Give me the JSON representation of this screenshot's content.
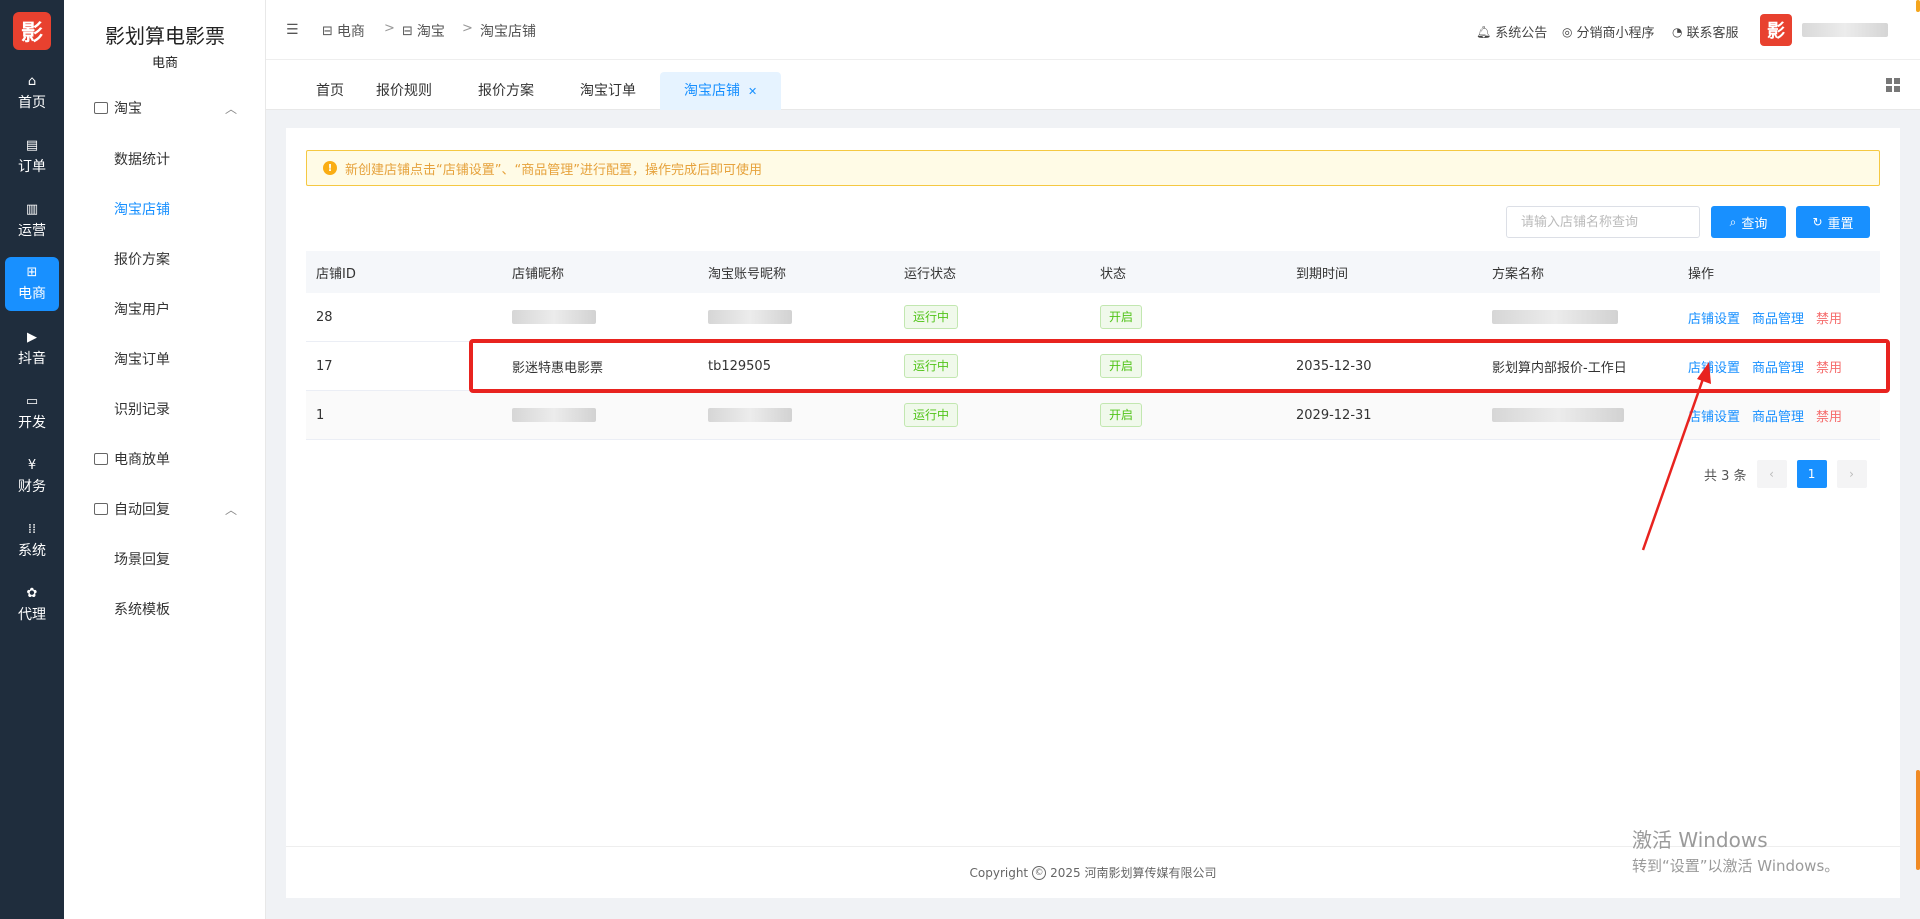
{
  "rail": {
    "logo": "影",
    "items": [
      {
        "label": "首页",
        "icon": "home-icon",
        "glyph": "⌂"
      },
      {
        "label": "订单",
        "icon": "order-icon",
        "glyph": "▤"
      },
      {
        "label": "运营",
        "icon": "chart-icon",
        "glyph": "▥"
      },
      {
        "label": "电商",
        "icon": "shop-icon",
        "glyph": "⊞"
      },
      {
        "label": "抖音",
        "icon": "video-icon",
        "glyph": "▶"
      },
      {
        "label": "开发",
        "icon": "code-icon",
        "glyph": "▭"
      },
      {
        "label": "财务",
        "icon": "yen-icon",
        "glyph": "¥"
      },
      {
        "label": "系统",
        "icon": "apps-icon",
        "glyph": "⁞⁞"
      },
      {
        "label": "代理",
        "icon": "agent-icon",
        "glyph": "✿"
      }
    ]
  },
  "side": {
    "title": "影划算电影票",
    "subtitle": "电商",
    "groups": [
      {
        "label": "淘宝"
      },
      {
        "label": "电商放单"
      },
      {
        "label": "自动回复"
      }
    ],
    "items": [
      {
        "label": "数据统计"
      },
      {
        "label": "淘宝店铺"
      },
      {
        "label": "报价方案"
      },
      {
        "label": "淘宝用户"
      },
      {
        "label": "淘宝订单"
      },
      {
        "label": "识别记录"
      },
      {
        "label": "场景回复"
      },
      {
        "label": "系统模板"
      }
    ]
  },
  "header": {
    "breadcrumb": [
      "电商",
      "淘宝",
      "淘宝店铺"
    ],
    "sep": ">",
    "links": [
      {
        "label": "系统公告",
        "icon": "bell-icon"
      },
      {
        "label": "分销商小程序",
        "icon": "miniapp-icon"
      },
      {
        "label": "联系客服",
        "icon": "headset-icon"
      }
    ],
    "avatar": "影"
  },
  "tabs": [
    {
      "label": "首页"
    },
    {
      "label": "报价规则"
    },
    {
      "label": "报价方案"
    },
    {
      "label": "淘宝订单"
    },
    {
      "label": "淘宝店铺",
      "active": true
    }
  ],
  "alert": "新创建店铺点击“店铺设置”、“商品管理”进行配置，操作完成后即可使用",
  "search": {
    "placeholder": "请输入店铺名称查询",
    "query_label": "查询",
    "reset_label": "重置"
  },
  "table": {
    "headers": [
      "店铺ID",
      "店铺昵称",
      "淘宝账号昵称",
      "运行状态",
      "状态",
      "到期时间",
      "方案名称",
      "操作"
    ],
    "rows": [
      {
        "id": "28",
        "shop_name": "",
        "account": "",
        "run_status": "运行中",
        "status": "开启",
        "expire": "",
        "plan": ""
      },
      {
        "id": "17",
        "shop_name": "影迷特惠电影票",
        "account": "tb129505",
        "run_status": "运行中",
        "status": "开启",
        "expire": "2035-12-30",
        "plan": "影划算内部报价-工作日"
      },
      {
        "id": "1",
        "shop_name": "",
        "account": "",
        "run_status": "运行中",
        "status": "开启",
        "expire": "2029-12-31",
        "plan": ""
      }
    ],
    "actions": [
      "店铺设置",
      "商品管理",
      "禁用"
    ]
  },
  "pager": {
    "total": "共 3 条",
    "current": "1",
    "prev": "‹",
    "next": "›"
  },
  "footer": {
    "prefix": "Copyright",
    "mark": "©",
    "text": "2025 河南影划算传媒有限公司"
  },
  "watermark": {
    "line1": "激活 Windows",
    "line2": "转到“设置”以激活 Windows。"
  },
  "colors": {
    "primary": "#1890ff",
    "rail": "#1f2d3d",
    "annotation": "#e8231f",
    "success": "#52c41a",
    "danger": "#f56c6c"
  }
}
